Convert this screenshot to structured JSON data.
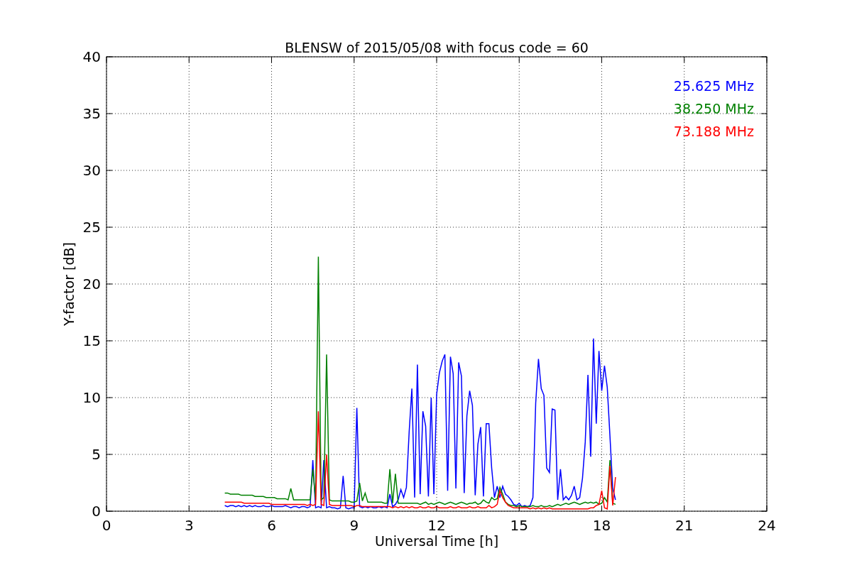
{
  "chart_data": {
    "type": "line",
    "title": "BLENSW of 2015/05/08 with focus code = 60",
    "xlabel": "Universal Time [h]",
    "ylabel": "Y-factor [dB]",
    "x": [
      4.3,
      4.4,
      4.5,
      4.6,
      4.7,
      4.8,
      4.9,
      5.0,
      5.1,
      5.2,
      5.3,
      5.4,
      5.5,
      5.6,
      5.7,
      5.8,
      5.9,
      6.0,
      6.1,
      6.2,
      6.3,
      6.4,
      6.5,
      6.6,
      6.7,
      6.8,
      6.9,
      7.0,
      7.1,
      7.2,
      7.3,
      7.4,
      7.5,
      7.6,
      7.7,
      7.8,
      7.9,
      8.0,
      8.1,
      8.2,
      8.3,
      8.4,
      8.5,
      8.6,
      8.7,
      8.8,
      8.9,
      9.0,
      9.1,
      9.2,
      9.3,
      9.4,
      9.5,
      9.6,
      9.7,
      9.8,
      9.9,
      10.0,
      10.1,
      10.2,
      10.3,
      10.4,
      10.5,
      10.6,
      10.7,
      10.8,
      10.9,
      11.0,
      11.1,
      11.2,
      11.3,
      11.4,
      11.5,
      11.6,
      11.7,
      11.8,
      11.9,
      12.0,
      12.1,
      12.2,
      12.3,
      12.4,
      12.5,
      12.6,
      12.7,
      12.8,
      12.9,
      13.0,
      13.1,
      13.2,
      13.3,
      13.4,
      13.5,
      13.6,
      13.7,
      13.8,
      13.9,
      14.0,
      14.1,
      14.2,
      14.3,
      14.4,
      14.5,
      14.6,
      14.7,
      14.8,
      14.9,
      15.0,
      15.1,
      15.2,
      15.3,
      15.4,
      15.5,
      15.6,
      15.7,
      15.8,
      15.9,
      16.0,
      16.1,
      16.2,
      16.3,
      16.4,
      16.5,
      16.6,
      16.7,
      16.8,
      16.9,
      17.0,
      17.1,
      17.2,
      17.3,
      17.4,
      17.5,
      17.6,
      17.7,
      17.8,
      17.9,
      18.0,
      18.1,
      18.2,
      18.3,
      18.4,
      18.5
    ],
    "series": [
      {
        "name": "25.625 MHz",
        "color": "#0000ff",
        "values": [
          0.5,
          0.4,
          0.5,
          0.5,
          0.4,
          0.5,
          0.4,
          0.5,
          0.4,
          0.5,
          0.4,
          0.5,
          0.4,
          0.4,
          0.5,
          0.4,
          0.4,
          0.5,
          0.4,
          0.4,
          0.4,
          0.4,
          0.5,
          0.4,
          0.3,
          0.4,
          0.4,
          0.3,
          0.4,
          0.4,
          0.3,
          0.4,
          4.5,
          0.3,
          0.4,
          0.3,
          4.5,
          0.3,
          0.4,
          0.3,
          0.3,
          0.2,
          0.3,
          3.1,
          0.3,
          0.2,
          0.3,
          0.3,
          9.1,
          0.4,
          0.3,
          0.4,
          0.3,
          0.4,
          0.3,
          0.3,
          0.4,
          0.3,
          0.4,
          0.3,
          1.5,
          0.4,
          0.6,
          1.0,
          1.9,
          1.2,
          2.1,
          7.0,
          10.8,
          1.2,
          12.9,
          1.5,
          8.8,
          7.5,
          1.3,
          10.0,
          1.5,
          10.3,
          12.2,
          13.2,
          13.8,
          1.8,
          13.6,
          12.1,
          2.0,
          13.1,
          11.9,
          1.6,
          8.4,
          10.6,
          9.3,
          1.4,
          5.9,
          7.4,
          1.3,
          7.7,
          7.7,
          3.8,
          1.2,
          2.2,
          1.2,
          2.2,
          1.5,
          1.3,
          1.0,
          0.6,
          0.5,
          0.7,
          0.4,
          0.5,
          0.4,
          0.5,
          1.2,
          9.5,
          13.4,
          10.8,
          10.2,
          3.8,
          3.4,
          9.0,
          8.9,
          1.0,
          3.7,
          1.0,
          1.3,
          1.0,
          1.4,
          2.2,
          1.0,
          1.2,
          2.9,
          6.1,
          12.0,
          4.8,
          15.2,
          7.7,
          14.1,
          10.6,
          12.8,
          10.9,
          6.6,
          2.0,
          1.0
        ]
      },
      {
        "name": "38.250 MHz",
        "color": "#008000",
        "values": [
          1.6,
          1.6,
          1.5,
          1.5,
          1.5,
          1.5,
          1.4,
          1.4,
          1.4,
          1.4,
          1.4,
          1.3,
          1.3,
          1.3,
          1.3,
          1.2,
          1.2,
          1.2,
          1.2,
          1.1,
          1.1,
          1.1,
          1.1,
          1.0,
          2.0,
          1.0,
          1.0,
          1.0,
          1.0,
          1.0,
          1.0,
          1.0,
          3.7,
          1.0,
          22.4,
          1.0,
          1.2,
          13.8,
          1.0,
          0.9,
          0.9,
          0.9,
          0.9,
          0.9,
          0.9,
          0.9,
          0.8,
          0.8,
          0.9,
          2.5,
          0.9,
          1.6,
          0.8,
          0.8,
          0.8,
          0.8,
          0.8,
          0.8,
          0.7,
          0.7,
          3.7,
          0.7,
          3.3,
          0.7,
          0.7,
          0.7,
          0.7,
          0.7,
          0.7,
          0.7,
          0.7,
          0.6,
          0.7,
          0.8,
          0.6,
          0.7,
          0.6,
          0.7,
          0.8,
          0.7,
          0.6,
          0.7,
          0.8,
          0.7,
          0.6,
          0.7,
          0.8,
          0.7,
          0.6,
          0.7,
          0.7,
          0.8,
          0.6,
          0.7,
          1.0,
          0.8,
          0.7,
          1.2,
          1.0,
          1.1,
          2.1,
          1.5,
          0.8,
          0.6,
          0.5,
          0.5,
          0.4,
          0.5,
          0.4,
          0.4,
          0.4,
          0.4,
          0.5,
          0.4,
          0.4,
          0.5,
          0.4,
          0.4,
          0.5,
          0.4,
          0.5,
          0.6,
          0.5,
          0.6,
          0.7,
          0.6,
          0.7,
          0.8,
          0.7,
          0.6,
          0.7,
          0.8,
          0.7,
          0.8,
          0.7,
          0.8,
          0.6,
          0.7,
          1.2,
          0.8,
          4.5,
          0.7,
          0.6
        ]
      },
      {
        "name": "73.188 MHz",
        "color": "#ff0000",
        "values": [
          0.8,
          0.8,
          0.8,
          0.8,
          0.8,
          0.8,
          0.8,
          0.7,
          0.7,
          0.7,
          0.7,
          0.7,
          0.7,
          0.7,
          0.7,
          0.7,
          0.7,
          0.6,
          0.6,
          0.6,
          0.6,
          0.6,
          0.6,
          0.6,
          0.6,
          0.6,
          0.6,
          0.6,
          0.6,
          0.6,
          0.5,
          0.6,
          0.5,
          0.6,
          8.8,
          0.6,
          0.5,
          5.0,
          0.6,
          0.5,
          0.5,
          0.5,
          0.5,
          0.5,
          0.5,
          0.5,
          0.5,
          0.4,
          0.5,
          0.5,
          0.4,
          0.4,
          0.4,
          0.4,
          0.4,
          0.4,
          0.4,
          0.4,
          0.4,
          0.4,
          0.4,
          0.3,
          0.4,
          0.3,
          0.4,
          0.3,
          0.4,
          0.3,
          0.4,
          0.3,
          0.3,
          0.4,
          0.3,
          0.3,
          0.4,
          0.3,
          0.3,
          0.4,
          0.3,
          0.3,
          0.3,
          0.3,
          0.4,
          0.3,
          0.3,
          0.4,
          0.3,
          0.3,
          0.3,
          0.4,
          0.3,
          0.3,
          0.4,
          0.3,
          0.3,
          0.3,
          0.5,
          0.3,
          0.4,
          0.6,
          1.8,
          1.2,
          0.8,
          0.5,
          0.4,
          0.3,
          0.3,
          0.3,
          0.3,
          0.3,
          0.3,
          0.2,
          0.3,
          0.2,
          0.3,
          0.2,
          0.3,
          0.2,
          0.3,
          0.2,
          0.2,
          0.2,
          0.2,
          0.2,
          0.2,
          0.2,
          0.2,
          0.2,
          0.2,
          0.2,
          0.2,
          0.2,
          0.2,
          0.3,
          0.3,
          0.5,
          0.6,
          1.8,
          0.3,
          0.2,
          4.0,
          0.5,
          3.0
        ]
      }
    ],
    "grid": true,
    "xlim": [
      0,
      24
    ],
    "ylim": [
      0,
      40
    ],
    "xticks": [
      0,
      3,
      6,
      9,
      12,
      15,
      18,
      21,
      24
    ],
    "yticks": [
      0,
      5,
      10,
      15,
      20,
      25,
      30,
      35,
      40
    ]
  }
}
